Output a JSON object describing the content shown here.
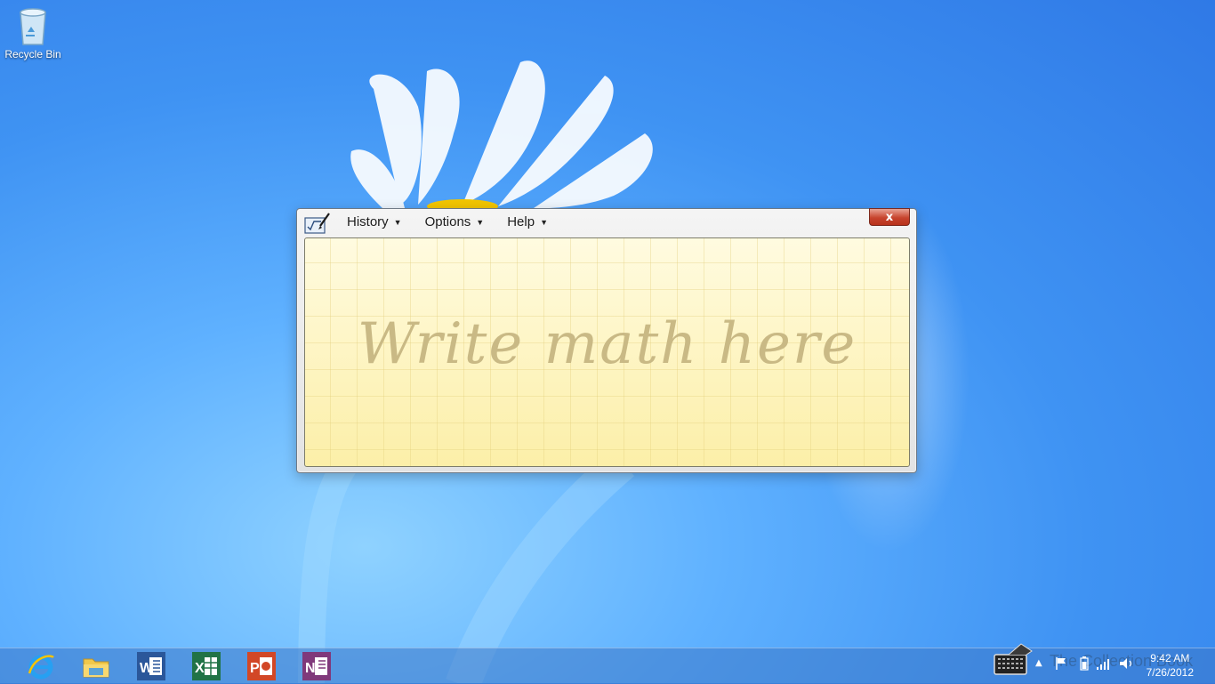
{
  "desktop": {
    "icons": [
      {
        "label": "Recycle Bin",
        "icon": "recycle-bin-icon"
      }
    ]
  },
  "window": {
    "app_icon": "math-input-panel-icon",
    "menu": [
      {
        "label": "History",
        "icon": "caret-down-icon"
      },
      {
        "label": "Options",
        "icon": "caret-down-icon"
      },
      {
        "label": "Help",
        "icon": "caret-down-icon"
      }
    ],
    "close_label": "x",
    "canvas_placeholder": "Write math here"
  },
  "taskbar": {
    "pinned": [
      {
        "name": "internet-explorer-icon",
        "color": "#1e88e5"
      },
      {
        "name": "file-explorer-icon",
        "color": "#f1c84b"
      },
      {
        "name": "word-icon",
        "color": "#2b579a"
      },
      {
        "name": "excel-icon",
        "color": "#217346"
      },
      {
        "name": "powerpoint-icon",
        "color": "#d24726"
      },
      {
        "name": "onenote-icon",
        "color": "#80397b"
      }
    ],
    "tray": {
      "icons": [
        "touch-keyboard-icon",
        "show-hidden-icons-icon",
        "action-center-flag-icon",
        "battery-icon",
        "network-icon",
        "volume-icon"
      ],
      "watermark": "The Collection Book",
      "time": "9:42 AM",
      "date": "7/26/2012"
    }
  },
  "colors": {
    "desktop_blue": "#3f93f3",
    "close_red": "#c7442d",
    "canvas_yellow": "#fdf6c3"
  }
}
